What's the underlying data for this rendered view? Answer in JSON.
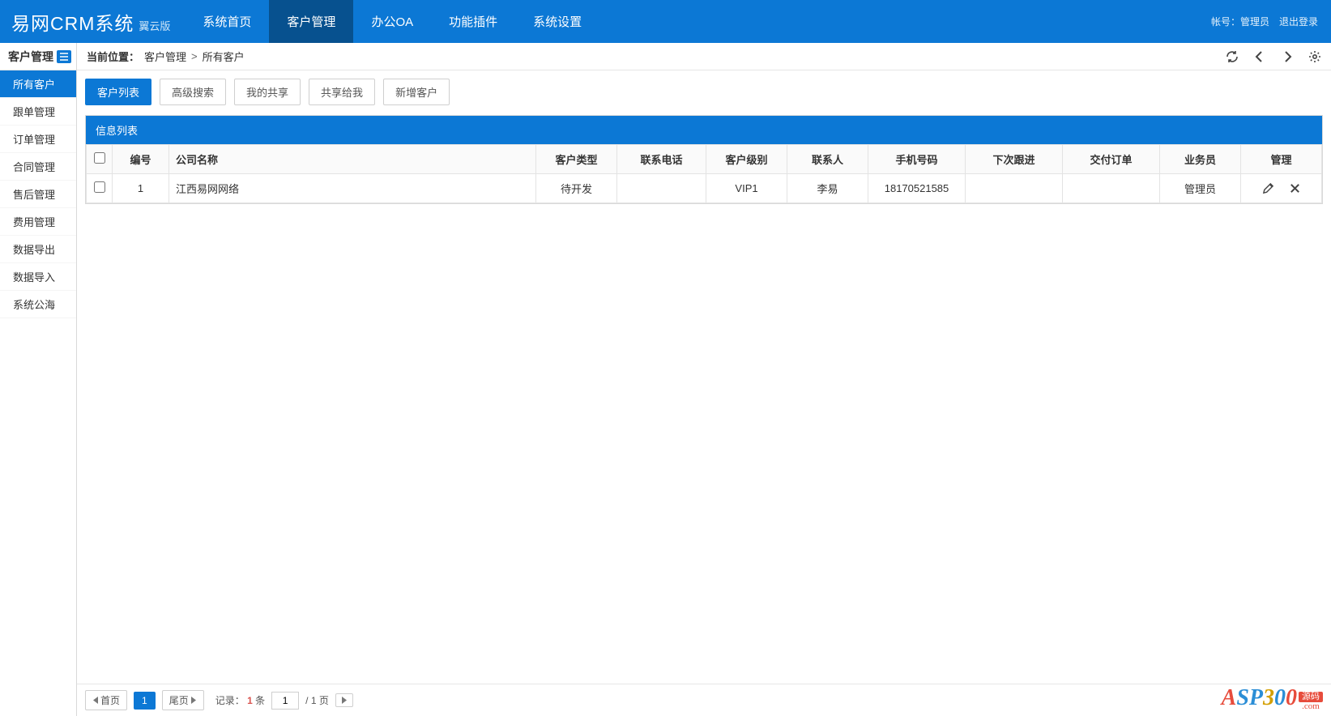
{
  "brand": {
    "main": "易网CRM系统",
    "sub": "翼云版"
  },
  "nav": {
    "items": [
      {
        "label": "系统首页"
      },
      {
        "label": "客户管理"
      },
      {
        "label": "办公OA"
      },
      {
        "label": "功能插件"
      },
      {
        "label": "系统设置"
      }
    ],
    "active_index": 1,
    "account_prefix": "帐号：",
    "account_user": "管理员",
    "logout": "退出登录"
  },
  "sidebar": {
    "header": "客户管理",
    "items": [
      {
        "label": "所有客户"
      },
      {
        "label": "跟单管理"
      },
      {
        "label": "订单管理"
      },
      {
        "label": "合同管理"
      },
      {
        "label": "售后管理"
      },
      {
        "label": "费用管理"
      },
      {
        "label": "数据导出"
      },
      {
        "label": "数据导入"
      },
      {
        "label": "系统公海"
      }
    ],
    "active_index": 0
  },
  "breadcrumb": {
    "label": "当前位置：",
    "group": "客户管理",
    "sep": ">",
    "page": "所有客户"
  },
  "tabs": {
    "items": [
      {
        "label": "客户列表"
      },
      {
        "label": "高级搜索"
      },
      {
        "label": "我的共享"
      },
      {
        "label": "共享给我"
      },
      {
        "label": "新增客户"
      }
    ],
    "active_index": 0
  },
  "panel": {
    "title": "信息列表",
    "columns": [
      "编号",
      "公司名称",
      "客户类型",
      "联系电话",
      "客户级别",
      "联系人",
      "手机号码",
      "下次跟进",
      "交付订单",
      "业务员",
      "管理"
    ],
    "rows": [
      {
        "num": "1",
        "company": "江西易网网络",
        "type": "待开发",
        "phone": "",
        "level": "VIP1",
        "contact": "李易",
        "mobile": "18170521585",
        "next": "",
        "order": "",
        "sales": "管理员"
      }
    ]
  },
  "pager": {
    "first": "首页",
    "last": "尾页",
    "current_page": "1",
    "records_label": "记录：",
    "records_count": "1",
    "records_unit": "条",
    "goto_value": "1",
    "total_sep": "/",
    "total_pages": "1",
    "page_unit": "页"
  },
  "watermark": {
    "text": "ASP300",
    "badge": "源码",
    "dotcom": ".com"
  }
}
